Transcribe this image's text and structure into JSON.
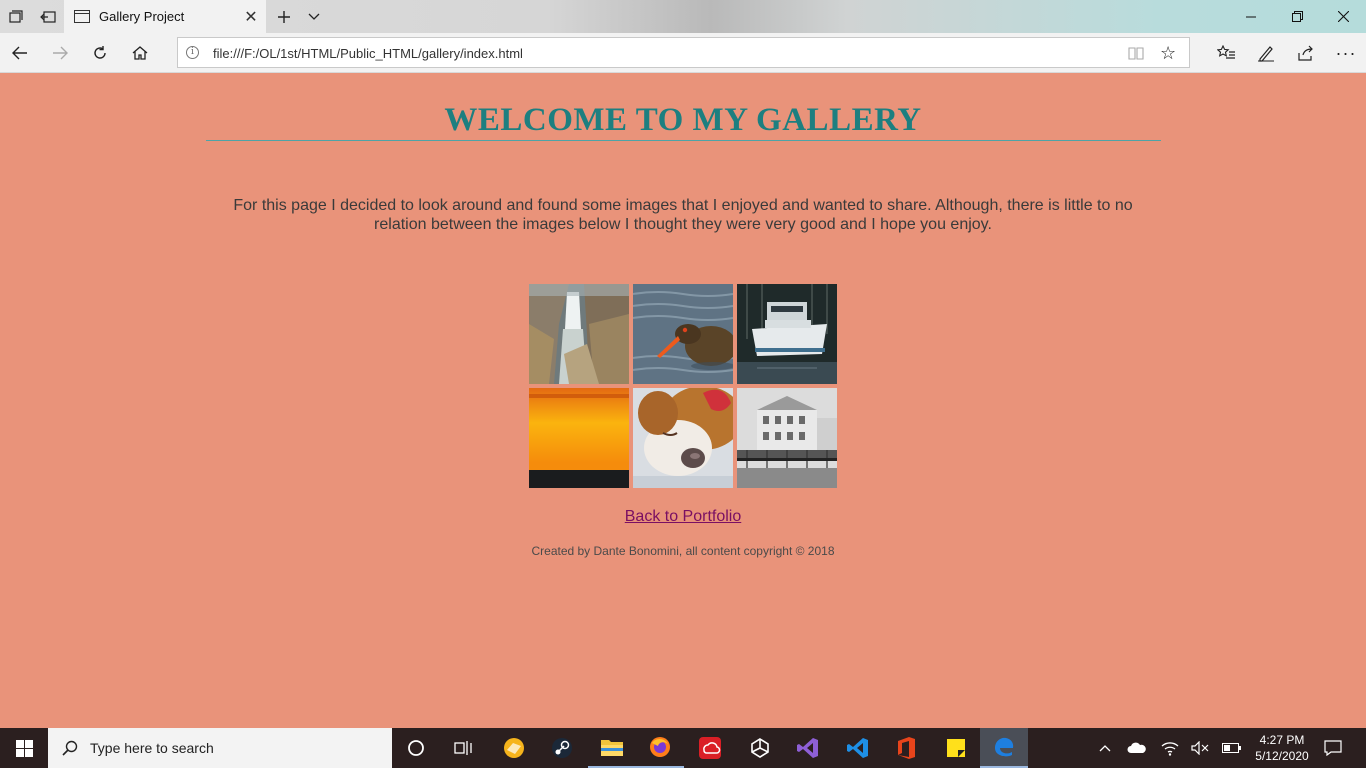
{
  "browser": {
    "tab_title": "Gallery Project",
    "url": "file:///F:/OL/1st/HTML/Public_HTML/gallery/index.html"
  },
  "page": {
    "heading": "WELCOME TO MY GALLERY",
    "intro": "For this page I decided to look around and found some images that I enjoyed and wanted to share. Although, there is little to no relation between the images below I thought they were very good and I hope you enjoy.",
    "back_link": "Back to Portfolio",
    "footer": "Created by Dante Bonomini, all content copyright © 2018",
    "background_color": "#e9937a",
    "heading_color": "#1d7f80",
    "link_color": "#7a0f63",
    "gallery": [
      {
        "subject": "waterfall-canyon"
      },
      {
        "subject": "oystercatcher-bird"
      },
      {
        "subject": "boat-at-dock"
      },
      {
        "subject": "orange-sunset"
      },
      {
        "subject": "sleeping-puppy"
      },
      {
        "subject": "harbor-building-bw"
      }
    ]
  },
  "taskbar": {
    "search_placeholder": "Type here to search",
    "time": "4:27 PM",
    "date": "5/12/2020",
    "apps": [
      "cortana-icon",
      "task-view-icon",
      "tandem-icon",
      "steam-icon",
      "file-explorer-icon",
      "firefox-icon",
      "adobe-cc-icon",
      "unity-icon",
      "visual-studio-icon",
      "vscode-icon",
      "office-icon",
      "sticky-notes-icon",
      "edge-icon"
    ]
  }
}
